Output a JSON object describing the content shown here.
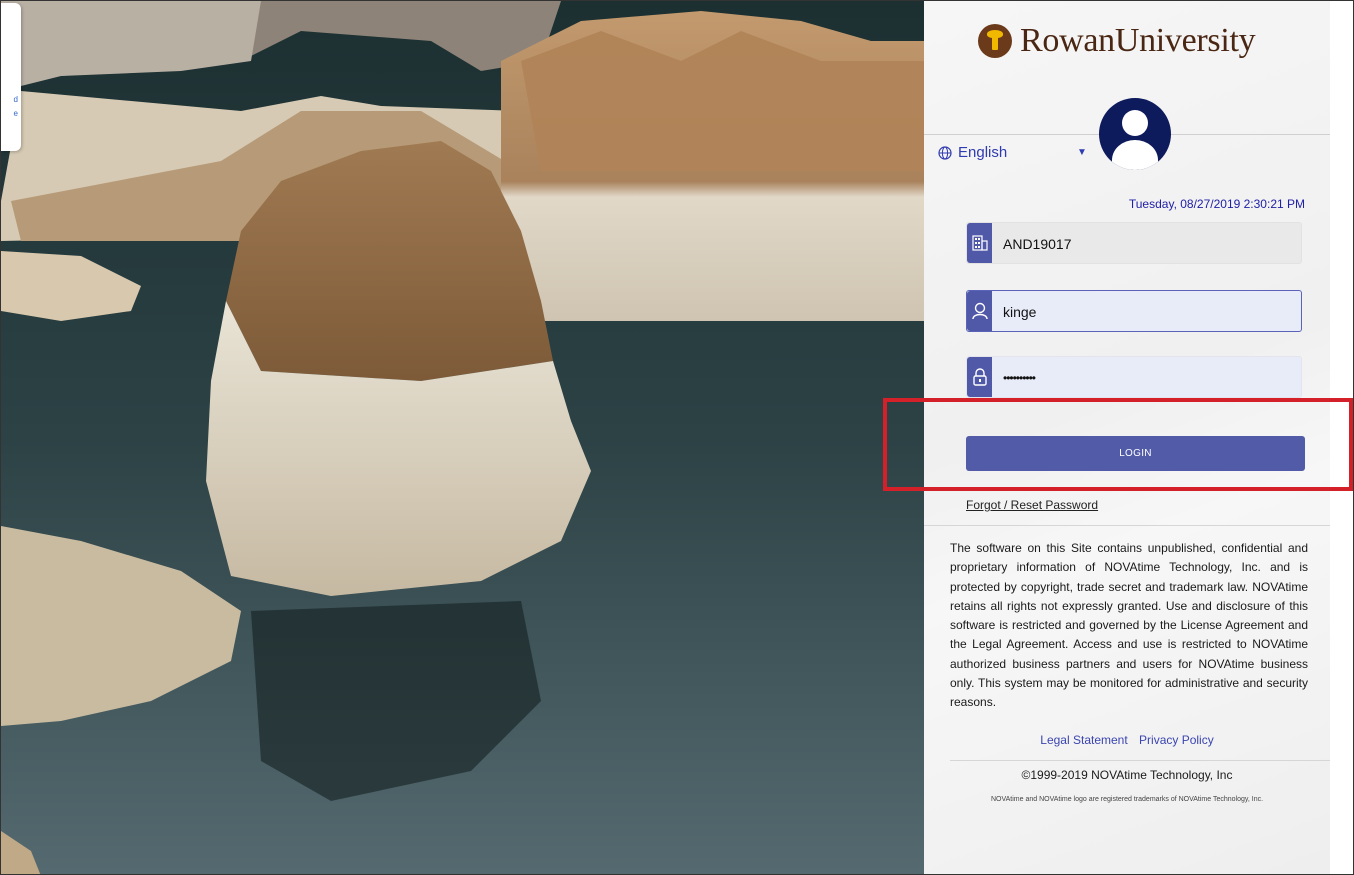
{
  "brand": {
    "logo_text": "RowanUniversity"
  },
  "language": {
    "selected": "English"
  },
  "clock": {
    "datetime": "Tuesday, 08/27/2019 2:30:21 PM"
  },
  "fields": {
    "company": {
      "value": "AND19017"
    },
    "username": {
      "value": "kinge"
    },
    "password": {
      "value": "••••••••••"
    }
  },
  "actions": {
    "login_label": "LOGIN",
    "forgot_label": "Forgot / Reset Password"
  },
  "legal": {
    "text": "The software on this Site contains unpublished, confidential and proprietary information of NOVAtime Technology, Inc. and is protected by copyright, trade secret and trademark law. NOVAtime retains all rights not expressly granted. Use and disclosure of this software is restricted and governed by the License Agreement and the Legal Agreement. Access and use is restricted to NOVAtime authorized business partners and users for NOVAtime business only. This system may be monitored for administrative and security reasons.",
    "legal_statement_link": "Legal Statement",
    "privacy_policy_link": "Privacy Policy"
  },
  "footer": {
    "copyright": "©1999-2019 NOVAtime Technology, Inc",
    "trademark": "NOVAtime and NOVAtime logo are registered trademarks of NOVAtime Technology, Inc."
  },
  "side_tab": {
    "chars": [
      "d",
      "e"
    ]
  },
  "colors": {
    "accent": "#525ba7",
    "highlight": "#d42028",
    "avatar": "#0d1a5c",
    "brand": "#4a2714"
  }
}
